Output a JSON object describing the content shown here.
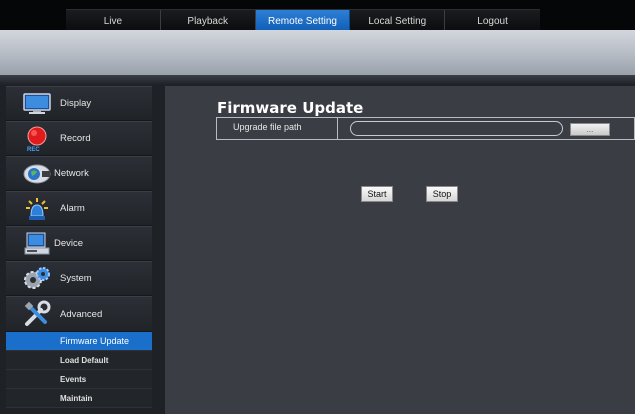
{
  "nav": {
    "tabs": [
      {
        "label": "Live"
      },
      {
        "label": "Playback"
      },
      {
        "label": "Remote Setting"
      },
      {
        "label": "Local Setting"
      },
      {
        "label": "Logout"
      }
    ],
    "active_tab": "Remote Setting"
  },
  "sidebar": {
    "items": [
      {
        "label": "Display",
        "icon": "monitor-icon"
      },
      {
        "label": "Record",
        "icon": "record-icon"
      },
      {
        "label": "Network",
        "icon": "network-icon"
      },
      {
        "label": "Alarm",
        "icon": "alarm-icon"
      },
      {
        "label": "Device",
        "icon": "device-icon"
      },
      {
        "label": "System",
        "icon": "gears-icon"
      },
      {
        "label": "Advanced",
        "icon": "tools-icon"
      }
    ],
    "sub_items": [
      {
        "label": "Firmware Update"
      },
      {
        "label": "Load Default"
      },
      {
        "label": "Events"
      },
      {
        "label": "Maintain"
      }
    ],
    "active_sub_item": "Firmware Update"
  },
  "main": {
    "title": "Firmware Update",
    "path_label": "Upgrade file path",
    "path_value": "",
    "browse_label": "...",
    "start_label": "Start",
    "stop_label": "Stop"
  },
  "colors": {
    "accent": "#1a6fca",
    "nav_active": "#2e7fd6",
    "panel": "#3a3d43",
    "background": "#1e2126"
  }
}
